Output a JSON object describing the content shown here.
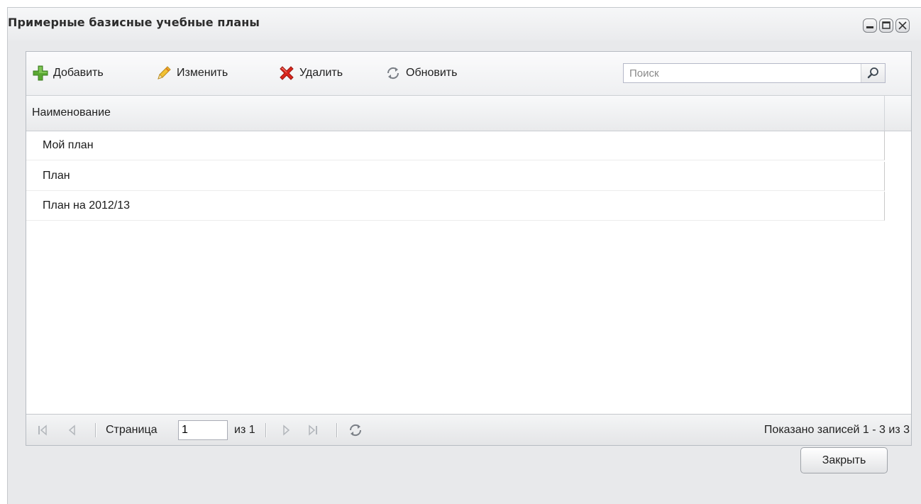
{
  "window": {
    "title": "Примерные базисные учебные планы"
  },
  "toolbar": {
    "add_label": "Добавить",
    "edit_label": "Изменить",
    "delete_label": "Удалить",
    "refresh_label": "Обновить",
    "search_placeholder": "Поиск"
  },
  "grid": {
    "columns": [
      "Наименование"
    ],
    "rows": [
      {
        "name": "Мой план"
      },
      {
        "name": "План"
      },
      {
        "name": "План на 2012/13"
      }
    ]
  },
  "paging": {
    "page_label": "Страница",
    "page_value": "1",
    "of_label": "из 1",
    "info": "Показано записей 1 - 3 из 3"
  },
  "footer": {
    "close_label": "Закрыть"
  },
  "icons": {
    "add": "plus-icon",
    "edit": "pencil-icon",
    "delete": "cross-icon",
    "refresh": "refresh-icon",
    "search": "magnifier-icon"
  },
  "colors": {
    "add_green": "#5aa832",
    "edit_yellow": "#f2c234",
    "delete_red": "#d9261c"
  }
}
